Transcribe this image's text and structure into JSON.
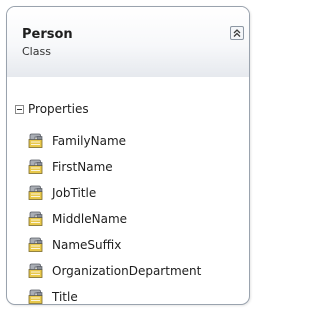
{
  "shape": {
    "title": "Person",
    "subtitle": "Class",
    "collapse_icon": "double-chevron-up-icon"
  },
  "compartment": {
    "label": "Properties",
    "toggle_icon": "collapse-minus-icon",
    "item_icon": "property-icon",
    "items": [
      {
        "name": "FamilyName"
      },
      {
        "name": "FirstName"
      },
      {
        "name": "JobTitle"
      },
      {
        "name": "MiddleName"
      },
      {
        "name": "NameSuffix"
      },
      {
        "name": "OrganizationDepartment"
      },
      {
        "name": "Title"
      }
    ]
  },
  "colors": {
    "border": "#9aa3ae",
    "header_gradient_end": "#e6e9ee",
    "icon_hand": "#8a8e96",
    "icon_card": "#e8c84a"
  }
}
